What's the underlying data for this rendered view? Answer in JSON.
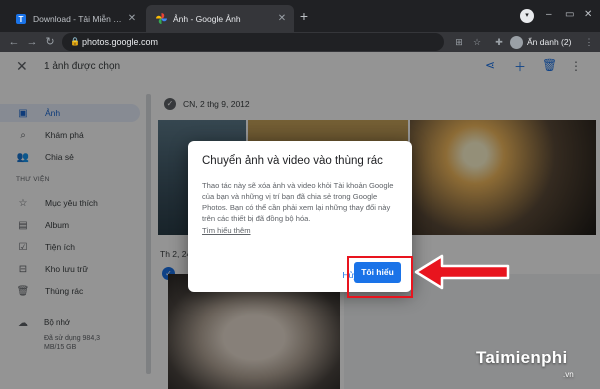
{
  "browser": {
    "tabs": [
      {
        "title": "Download - Tải Miễn Phí VN - Ph",
        "icon": "taimienphi-favicon",
        "state": "inactive"
      },
      {
        "title": "Ảnh - Google Ảnh",
        "icon": "google-photos-favicon",
        "state": "active"
      }
    ],
    "new_tab": "+",
    "url": "photos.google.com",
    "profile_label": "Ẩn danh (2)"
  },
  "photos_app": {
    "selection_label": "1 ảnh được chọn",
    "sidebar": {
      "items": [
        {
          "label": "Ảnh",
          "icon": "photo-icon",
          "active": true
        },
        {
          "label": "Khám phá",
          "icon": "search-icon",
          "active": false
        },
        {
          "label": "Chia sẻ",
          "icon": "people-icon",
          "active": false
        }
      ],
      "library_header": "THƯ VIỆN",
      "library_items": [
        {
          "label": "Mục yêu thích",
          "icon": "star-icon"
        },
        {
          "label": "Album",
          "icon": "album-icon"
        },
        {
          "label": "Tiện ích",
          "icon": "utilities-icon"
        },
        {
          "label": "Kho lưu trữ",
          "icon": "archive-icon"
        },
        {
          "label": "Thùng rác",
          "icon": "trash-icon"
        }
      ],
      "storage_label": "Bộ nhớ",
      "storage_detail": "Đã sử dụng 984,3 MB/15 GB"
    },
    "date_group_1": "CN, 2 thg 9, 2012",
    "date_group_2": "Th 2, 24"
  },
  "dialog": {
    "title": "Chuyển ảnh và video vào thùng rác",
    "body": "Thao tác này sẽ xóa ảnh và video khỏi Tài khoản Google của bạn và những vị trí bạn đã chia sẻ trong Google Photos. Bạn có thể cần phải xem lại những thay đổi này trên các thiết bị đã đồng bộ hóa.",
    "learn_more": "Tìm hiểu thêm",
    "cancel_label": "Hủy",
    "confirm_label": "Tôi hiểu"
  },
  "watermark": {
    "brand": "Taimienphi",
    "suffix": ".vn"
  },
  "colors": {
    "accent": "#1a73e8",
    "annotation_red": "#e8141e",
    "chrome_dark": "#202124"
  }
}
